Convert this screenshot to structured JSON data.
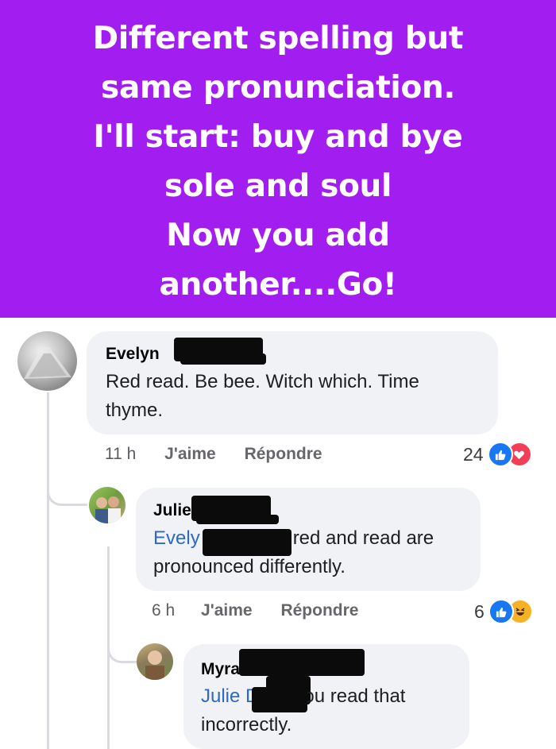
{
  "banner": {
    "lines": [
      "Different spelling but",
      "same pronunciation.",
      "I'll start: buy and bye",
      "sole and soul",
      "Now you add",
      "another....Go!"
    ],
    "background": "#a21ef0"
  },
  "comments": [
    {
      "name": "Evelyn",
      "text_lines": [
        "Red read. Be bee. Witch which. Time",
        "thyme."
      ],
      "time": "11 h",
      "like_label": "J'aime",
      "reply_label": "Répondre",
      "reaction_count": "24",
      "reactions": [
        "like-icon",
        "love-icon"
      ]
    },
    {
      "name": "Julie",
      "mention": "Evely",
      "text_line1_rest": "red and read are",
      "text_line2": "pronounced differently.",
      "time": "6 h",
      "like_label": "J'aime",
      "reply_label": "Répondre",
      "reaction_count": "6",
      "reactions": [
        "like-icon",
        "haha-icon"
      ]
    },
    {
      "name": "Myra",
      "mention": "Julie D",
      "text_line1_rest": "you read that",
      "text_line2": "incorrectly."
    }
  ],
  "colors": {
    "bubble": "#f0f2f5",
    "mention": "#2d6ac2",
    "like": "#1877f2",
    "love": "#f33e58",
    "haha": "#f7b125"
  }
}
